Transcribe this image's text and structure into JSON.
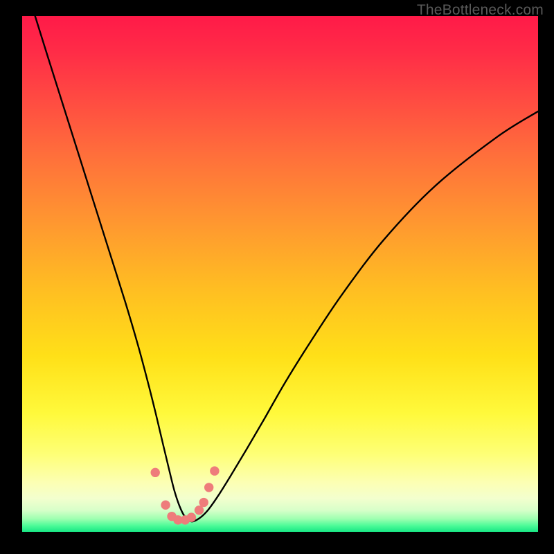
{
  "watermark": "TheBottleneck.com",
  "colors": {
    "background": "#000000",
    "curve": "#000000",
    "dot": "#ee7c7b",
    "gradient_stops": [
      {
        "offset": 0.0,
        "color": "#ff1a48"
      },
      {
        "offset": 0.07,
        "color": "#ff2c47"
      },
      {
        "offset": 0.16,
        "color": "#ff4a42"
      },
      {
        "offset": 0.27,
        "color": "#ff6f3b"
      },
      {
        "offset": 0.4,
        "color": "#ff9730"
      },
      {
        "offset": 0.53,
        "color": "#ffbe22"
      },
      {
        "offset": 0.66,
        "color": "#ffe018"
      },
      {
        "offset": 0.77,
        "color": "#fff93b"
      },
      {
        "offset": 0.85,
        "color": "#feff77"
      },
      {
        "offset": 0.905,
        "color": "#fcffb4"
      },
      {
        "offset": 0.935,
        "color": "#f3ffce"
      },
      {
        "offset": 0.958,
        "color": "#d8ffc9"
      },
      {
        "offset": 0.975,
        "color": "#9dffb0"
      },
      {
        "offset": 0.988,
        "color": "#4dfb98"
      },
      {
        "offset": 1.0,
        "color": "#18e684"
      }
    ]
  },
  "chart_data": {
    "type": "line",
    "title": "",
    "xlabel": "",
    "ylabel": "",
    "xlim": [
      0,
      100
    ],
    "ylim": [
      0,
      100
    ],
    "legend": false,
    "grid": false,
    "annotations": [],
    "series": [
      {
        "name": "bottleneck-curve",
        "x": [
          2.5,
          5,
          8,
          11,
          14,
          17,
          20,
          22.5,
          24.5,
          26,
          27.3,
          28.5,
          29.5,
          30.5,
          31.5,
          32.8,
          34.3,
          36,
          38,
          40.5,
          43.5,
          47,
          51,
          56,
          62,
          70,
          80,
          92,
          100
        ],
        "values": [
          100,
          92,
          82.5,
          73,
          63.5,
          54,
          44.5,
          36,
          28.5,
          22.5,
          17,
          12,
          8,
          5,
          3,
          2,
          2.6,
          4.2,
          7,
          11,
          16,
          22,
          29,
          37,
          46,
          56.5,
          67,
          76.5,
          81.5
        ]
      }
    ],
    "dots": {
      "name": "highlight-points",
      "points": [
        {
          "x": 25.8,
          "y": 11.5
        },
        {
          "x": 27.8,
          "y": 5.2
        },
        {
          "x": 29.0,
          "y": 3.0
        },
        {
          "x": 30.2,
          "y": 2.3
        },
        {
          "x": 31.6,
          "y": 2.3
        },
        {
          "x": 32.8,
          "y": 2.8
        },
        {
          "x": 34.3,
          "y": 4.2
        },
        {
          "x": 35.2,
          "y": 5.7
        },
        {
          "x": 36.2,
          "y": 8.6
        },
        {
          "x": 37.3,
          "y": 11.8
        }
      ],
      "radius": 0.9
    }
  }
}
